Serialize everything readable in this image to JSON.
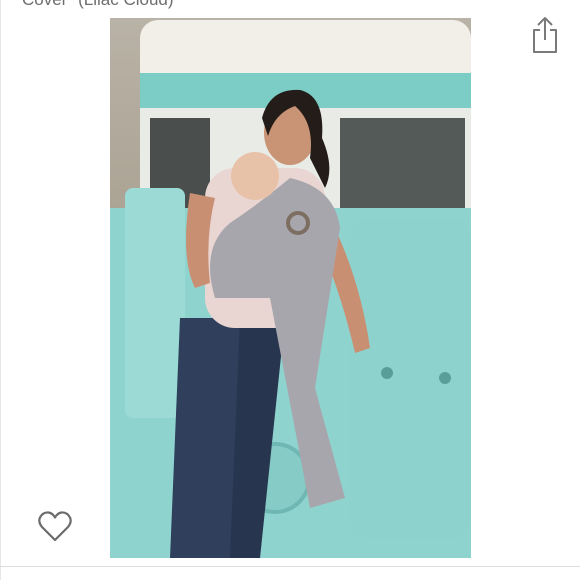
{
  "header": {
    "title_fragment": "Cover\" (Lilac Cloud)"
  },
  "icons": {
    "share": "share-icon",
    "favorite": "heart-outline-icon"
  },
  "image": {
    "alt": "Woman carrying baby in a grey ring sling, leaning on a turquoise vintage truck"
  },
  "colors": {
    "truck": "#8fd3cf",
    "sling": "#a8a6ad",
    "background": "#ffffff"
  }
}
